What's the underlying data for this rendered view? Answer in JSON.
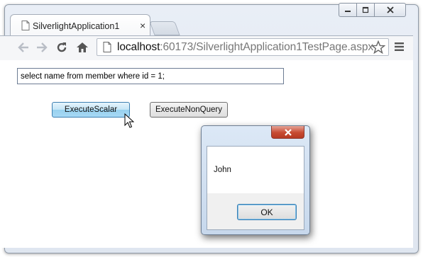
{
  "browser": {
    "tab_title": "SilverlightApplication1",
    "tab_close_glyph": "×",
    "url_host": "localhost",
    "url_rest": ":60173/SilverlightApplication1TestPage.aspx",
    "icons": [
      "back-icon",
      "forward-icon",
      "reload-icon",
      "home-icon",
      "page-icon",
      "bookmark-star-icon",
      "menu-icon",
      "minimize-icon",
      "maximize-icon",
      "close-icon"
    ]
  },
  "page": {
    "query_value": "select name from member where id = 1;",
    "execute_scalar_label": "ExecuteScalar",
    "execute_nonquery_label": "ExecuteNonQuery"
  },
  "dialog": {
    "message": "John",
    "ok_label": "OK"
  },
  "colors": {
    "accent_blue": "#3c7fb1",
    "close_red": "#c74a32",
    "frame": "#dfe6f0"
  }
}
